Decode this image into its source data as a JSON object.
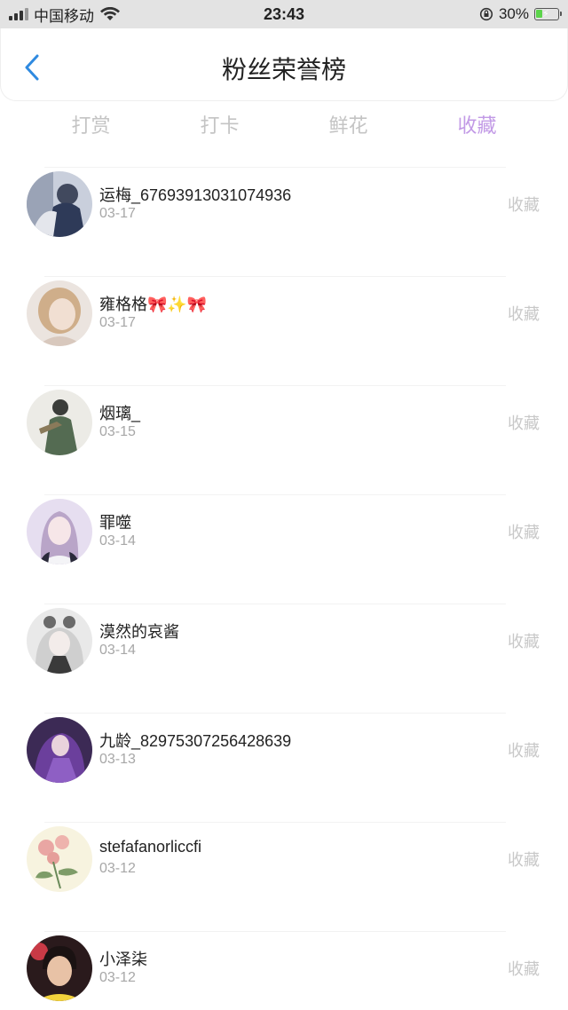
{
  "status_bar": {
    "carrier": "中国移动",
    "time": "23:43",
    "battery_pct": "30%",
    "battery_level": 0.3
  },
  "header": {
    "title": "粉丝荣誉榜",
    "back_icon": "chevron-left-icon"
  },
  "tabs": [
    {
      "label": "打赏",
      "active": false
    },
    {
      "label": "打卡",
      "active": false
    },
    {
      "label": "鲜花",
      "active": false
    },
    {
      "label": "收藏",
      "active": true
    }
  ],
  "list": [
    {
      "name": "运梅_67693913031074936",
      "date": "03-17",
      "action": "收藏"
    },
    {
      "name": "雍格格🎀✨🎀",
      "date": "03-17",
      "action": "收藏"
    },
    {
      "name": "烟璃_",
      "date": "03-15",
      "action": "收藏"
    },
    {
      "name": "罪噬",
      "date": "03-14",
      "action": "收藏"
    },
    {
      "name": "漠然的哀酱",
      "date": "03-14",
      "action": "收藏"
    },
    {
      "name": "九龄_82975307256428639",
      "date": "03-13",
      "action": "收藏"
    },
    {
      "name": "stefafanorliccfi",
      "date": "03-12",
      "action": "收藏"
    },
    {
      "name": "小泽柒",
      "date": "03-12",
      "action": "收藏"
    }
  ],
  "colors": {
    "accent": "#c29ae6",
    "back_arrow": "#2f8ae0"
  }
}
